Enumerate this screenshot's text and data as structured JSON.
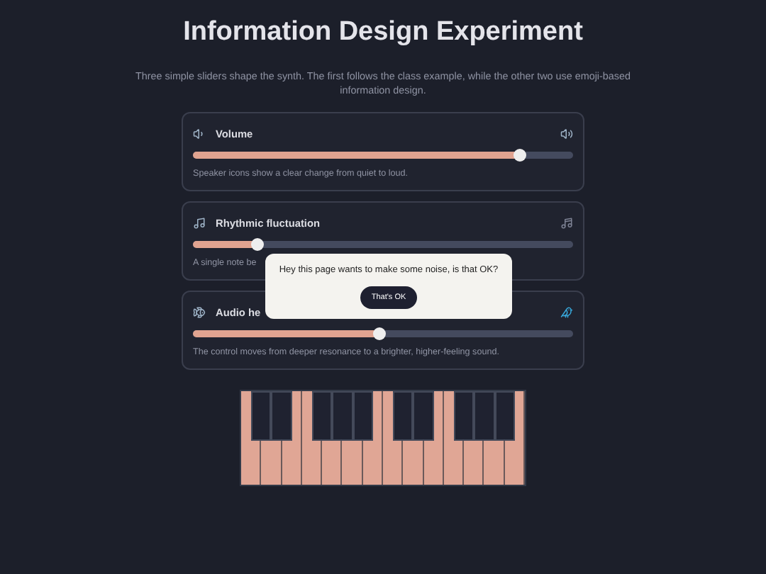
{
  "title": "Information Design Experiment",
  "intro": "Three simple sliders shape the synth. The first follows the class example, while the other two use emoji-based information design.",
  "sliders": [
    {
      "kind": "speaker",
      "label": "Volume",
      "level": 0.86,
      "description": "Speaker icons show a clear change from quiet to loud."
    },
    {
      "kind": "notes",
      "label": "Rhythmic fluctuation",
      "level": 0.17,
      "description": "A single note be"
    },
    {
      "kind": "animals",
      "label": "Audio he",
      "level": 0.49,
      "description": "The control moves from deeper resonance to a brighter, higher-feeling sound."
    }
  ],
  "dialog": {
    "message": "Hey this page wants to make some noise, is that OK?",
    "button": "That's OK"
  }
}
